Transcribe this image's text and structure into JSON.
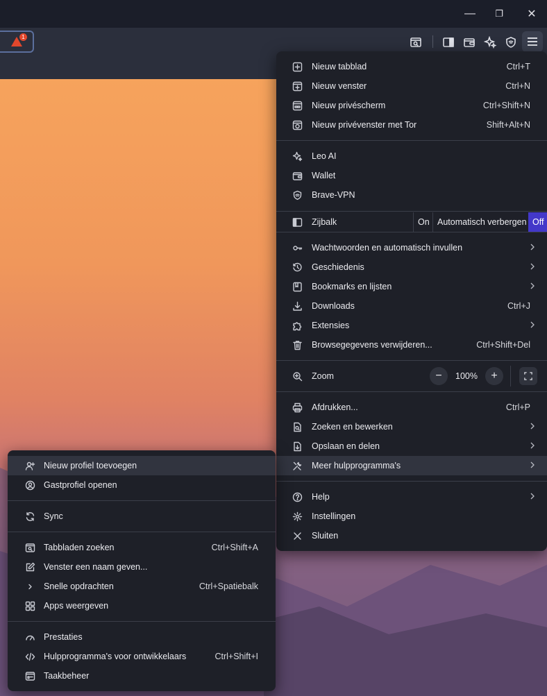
{
  "window": {
    "minimize_glyph": "—",
    "maximize_glyph": "❐",
    "close_glyph": "✕"
  },
  "toolbar": {
    "rewards_badge": "1"
  },
  "main_menu": {
    "new_tab": {
      "label": "Nieuw tabblad",
      "shortcut": "Ctrl+T"
    },
    "new_window": {
      "label": "Nieuw venster",
      "shortcut": "Ctrl+N"
    },
    "new_private": {
      "label": "Nieuw privéscherm",
      "shortcut": "Ctrl+Shift+N"
    },
    "new_tor": {
      "label": "Nieuw privévenster met Tor",
      "shortcut": "Shift+Alt+N"
    },
    "leo": {
      "label": "Leo AI"
    },
    "wallet": {
      "label": "Wallet"
    },
    "vpn": {
      "label": "Brave-VPN"
    },
    "sidebar": {
      "label": "Zijbalk",
      "on": "On",
      "auto_hide": "Automatisch verbergen",
      "off": "Off"
    },
    "passwords": {
      "label": "Wachtwoorden en automatisch invullen"
    },
    "history": {
      "label": "Geschiedenis"
    },
    "bookmarks": {
      "label": "Bookmarks en lijsten"
    },
    "downloads": {
      "label": "Downloads",
      "shortcut": "Ctrl+J"
    },
    "extensions": {
      "label": "Extensies"
    },
    "clear_data": {
      "label": "Browsegegevens verwijderen...",
      "shortcut": "Ctrl+Shift+Del"
    },
    "zoom": {
      "label": "Zoom",
      "minus": "−",
      "value": "100%",
      "plus": "+"
    },
    "print": {
      "label": "Afdrukken...",
      "shortcut": "Ctrl+P"
    },
    "find_edit": {
      "label": "Zoeken en bewerken"
    },
    "save_share": {
      "label": "Opslaan en delen"
    },
    "more_tools": {
      "label": "Meer hulpprogramma's"
    },
    "help": {
      "label": "Help"
    },
    "settings": {
      "label": "Instellingen"
    },
    "exit": {
      "label": "Sluiten"
    }
  },
  "sub_menu": {
    "add_profile": {
      "label": "Nieuw profiel toevoegen"
    },
    "guest_profile": {
      "label": "Gastprofiel openen"
    },
    "sync": {
      "label": "Sync"
    },
    "search_tabs": {
      "label": "Tabbladen zoeken",
      "shortcut": "Ctrl+Shift+A"
    },
    "name_window": {
      "label": "Venster een naam geven..."
    },
    "quick_commands": {
      "label": "Snelle opdrachten",
      "shortcut": "Ctrl+Spatiebalk"
    },
    "show_apps": {
      "label": "Apps weergeven"
    },
    "performance": {
      "label": "Prestaties"
    },
    "dev_tools": {
      "label": "Hulpprogramma's voor ontwikkelaars",
      "shortcut": "Ctrl+Shift+I"
    },
    "task_manager": {
      "label": "Taakbeheer"
    }
  },
  "colors": {
    "menu_bg": "#1e2028",
    "highlight": "#31343f",
    "accent_off": "#4338c9",
    "rewards": "#e2472c"
  }
}
